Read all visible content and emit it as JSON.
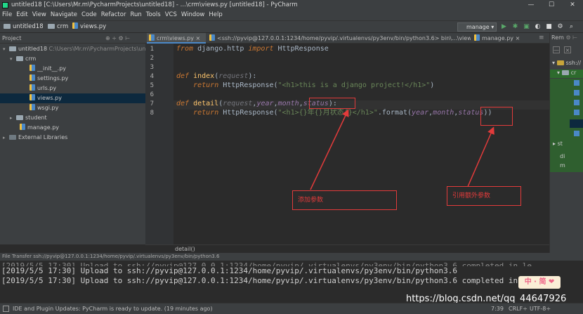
{
  "window": {
    "title": "untitled18 [C:\\Users\\Mr.m\\PycharmProjects\\untitled18] - ...\\crm\\views.py [untitled18] - PyCharm",
    "controls": [
      "—",
      "☐",
      "✕"
    ]
  },
  "menu": [
    "File",
    "Edit",
    "View",
    "Navigate",
    "Code",
    "Refactor",
    "Run",
    "Tools",
    "VCS",
    "Window",
    "Help"
  ],
  "navbar": {
    "crumbs": [
      "untitled18",
      "crm",
      "views.py"
    ],
    "run_config": "manage"
  },
  "project": {
    "header": "Project",
    "tree": [
      {
        "label": "untitled18",
        "path": "C:\\Users\\Mr.m\\PycharmProjects\\untitl"
      },
      {
        "label": "crm"
      },
      {
        "label": "__init__.py"
      },
      {
        "label": "settings.py"
      },
      {
        "label": "urls.py"
      },
      {
        "label": "views.py"
      },
      {
        "label": "wsgi.py"
      },
      {
        "label": "student"
      },
      {
        "label": "manage.py"
      },
      {
        "label": "External Libraries"
      }
    ]
  },
  "tabs": [
    {
      "label": "crm\\views.py",
      "close": "×"
    },
    {
      "label": "<ssh://pyvip@127.0.0.1:1234/home/pyvip/.virtualenvs/py3env/bin/python3.6> bin\\...\\views.py",
      "close": "×"
    },
    {
      "label": "manage.py",
      "close": "×"
    }
  ],
  "editor": {
    "line_numbers": [
      "1",
      "2",
      "3",
      "4",
      "5",
      "6",
      "7",
      "8"
    ],
    "code": {
      "l1_kw1": "from",
      "l1_mod": " django.http ",
      "l1_kw2": "import",
      "l1_name": " HttpResponse",
      "l4_kw": "def",
      "l4_fn": " index",
      "l4_p1": "(",
      "l4_prm": "request",
      "l4_p2": "):",
      "l5_indent": "    ",
      "l5_kw": "return",
      "l5_call": " HttpResponse(",
      "l5_str": "\"<h1>this is a django project!</h1>\"",
      "l5_end": ")",
      "l7_kw": "def",
      "l7_fn": " detail",
      "l7_p1": "(",
      "l7_prm": "request",
      "l7_c1": ",",
      "l7_year": "year",
      "l7_c2": ",",
      "l7_month": "month",
      "l7_c3": ",",
      "l7_status": "status",
      "l7_p2": "):",
      "l8_indent": "    ",
      "l8_kw": "return",
      "l8_call": " HttpResponse(",
      "l8_str": "\"<h1>{}年{}月状态{}</h1>\"",
      "l8_fmt": ".format(",
      "l8_year": "year",
      "l8_c1": ",",
      "l8_month": "month",
      "l8_c2": ",",
      "l8_status": "status",
      "l8_end": "))"
    },
    "footer": "detail()"
  },
  "annotations": {
    "add_param": "添加参数",
    "reference_extra": "引用额外参数"
  },
  "right_panel": {
    "header": "Rem",
    "items": [
      "ssh://",
      "cr",
      "st",
      "di",
      "m"
    ]
  },
  "file_transfer": {
    "header": "File Transfer ssh://pyvip@127.0.0.1:1234/home/pyvip/.virtualenvs/py3env/bin/python3.6",
    "lines": [
      "[2019/5/5 17:30] Upload to ssh://pyvip@127.0.0.1:1234/home/pyvip/.virtualenvs/py3env/bin/python3.6",
      "[2019/5/5 17:30] Upload to ssh://pyvip@127.0.0.1:1234/home/pyvip/.virtualenvs/py3env/bin/python3.6 completed in le"
    ]
  },
  "statusbar": {
    "message": "IDE and Plugin Updates: PyCharm is ready to update. (19 minutes ago)",
    "position": "7:39",
    "line_sep": "CRLF÷",
    "encoding": "UTF-8÷"
  },
  "watermark": "https://blog.csdn.net/qq_44647926",
  "ime_badge": "中 · 简 ❤"
}
